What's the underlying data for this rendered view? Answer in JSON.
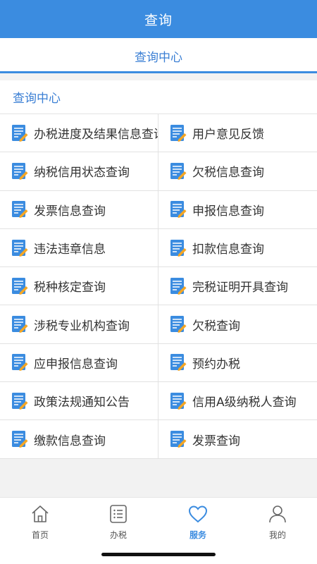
{
  "header": {
    "title": "查询"
  },
  "tab": {
    "label": "查询中心"
  },
  "section": {
    "title": "查询中心"
  },
  "items": [
    {
      "label": "办税进度及结果信息查询"
    },
    {
      "label": "用户意见反馈"
    },
    {
      "label": "纳税信用状态查询"
    },
    {
      "label": "欠税信息查询"
    },
    {
      "label": "发票信息查询"
    },
    {
      "label": "申报信息查询"
    },
    {
      "label": "违法违章信息"
    },
    {
      "label": "扣款信息查询"
    },
    {
      "label": "税种核定查询"
    },
    {
      "label": "完税证明开具查询"
    },
    {
      "label": "涉税专业机构查询"
    },
    {
      "label": "欠税查询"
    },
    {
      "label": "应申报信息查询"
    },
    {
      "label": "预约办税"
    },
    {
      "label": "政策法规通知公告"
    },
    {
      "label": "信用A级纳税人查询"
    },
    {
      "label": "缴款信息查询"
    },
    {
      "label": "发票查询"
    }
  ],
  "item_icon": "document-edit-icon",
  "nav": [
    {
      "label": "首页",
      "icon": "home-icon"
    },
    {
      "label": "办税",
      "icon": "list-icon"
    },
    {
      "label": "服务",
      "icon": "heart-icon",
      "active": true
    },
    {
      "label": "我的",
      "icon": "user-icon"
    }
  ],
  "colors": {
    "primary": "#3b8ce0",
    "accent_text": "#3b7fd4",
    "icon_pencil": "#f5a623"
  }
}
